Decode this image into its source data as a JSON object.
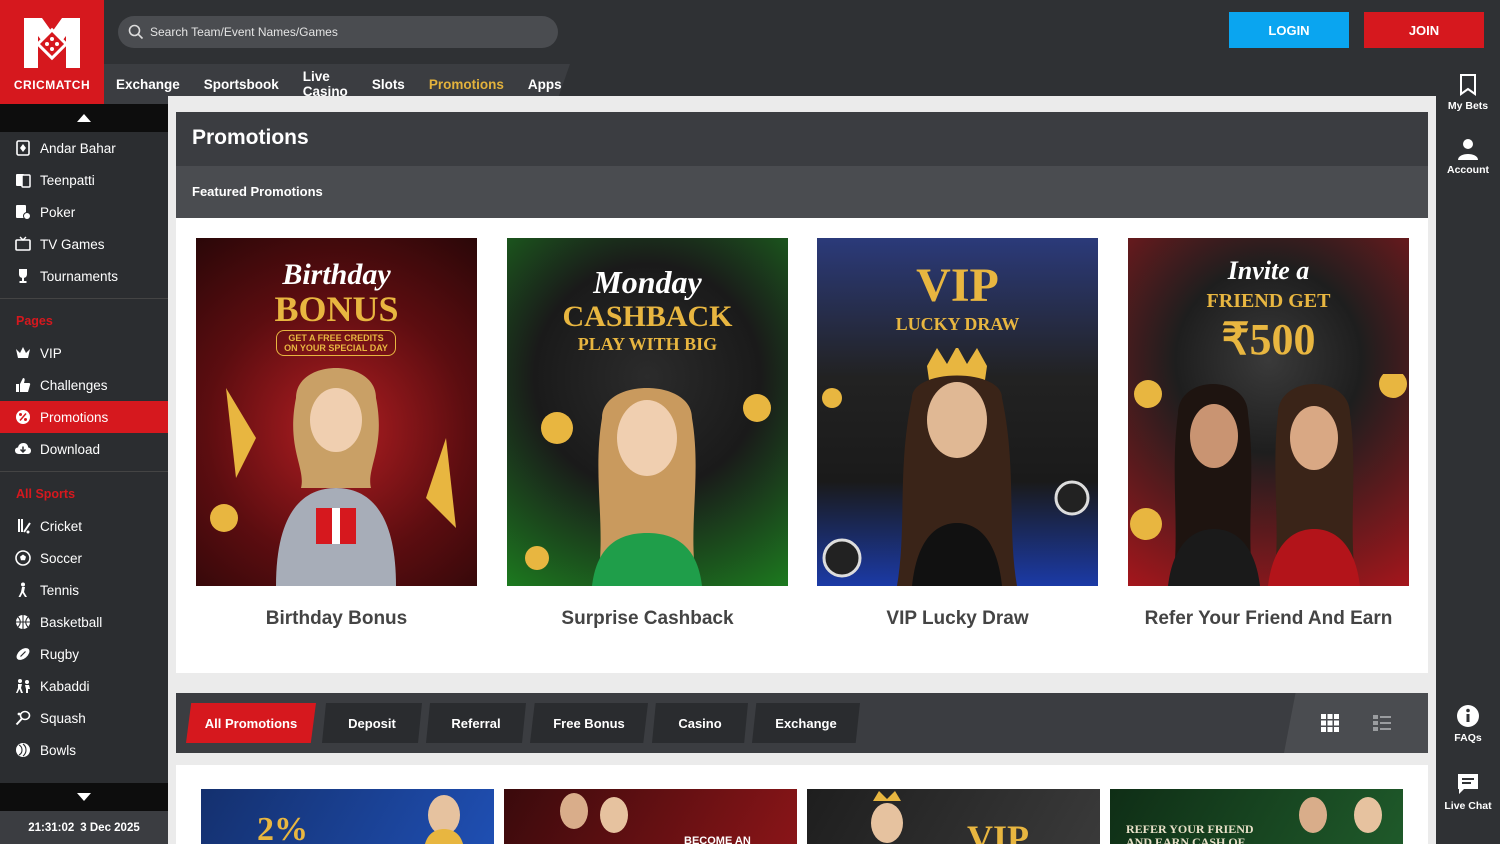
{
  "brand": {
    "name": "CRICMATCH",
    "primary_color": "#d6181e",
    "accent_color": "#0aa5f0",
    "gold_color": "#e3b23c"
  },
  "header": {
    "search_placeholder": "Search Team/Event Names/Games",
    "login_label": "LOGIN",
    "join_label": "JOIN"
  },
  "nav": {
    "items": [
      {
        "label": "Exchange",
        "active": false
      },
      {
        "label": "Sportsbook",
        "active": false
      },
      {
        "label": "Live Casino",
        "active": false
      },
      {
        "label": "Slots",
        "active": false
      },
      {
        "label": "Promotions",
        "active": true
      },
      {
        "label": "Apps",
        "active": false
      }
    ]
  },
  "rightrail": {
    "my_bets": "My Bets",
    "account": "Account",
    "faqs": "FAQs",
    "live_chat": "Live Chat"
  },
  "sidebar": {
    "top_items": [
      {
        "label": "Andar Bahar",
        "icon": "andar-bahar-icon"
      },
      {
        "label": "Teenpatti",
        "icon": "teenpatti-icon"
      },
      {
        "label": "Poker",
        "icon": "poker-icon"
      },
      {
        "label": "TV Games",
        "icon": "tv-icon"
      },
      {
        "label": "Tournaments",
        "icon": "trophy-icon"
      }
    ],
    "pages_heading": "Pages",
    "pages": [
      {
        "label": "VIP",
        "icon": "crown-icon",
        "active": false
      },
      {
        "label": "Challenges",
        "icon": "thumbs-up-icon",
        "active": false
      },
      {
        "label": "Promotions",
        "icon": "promotions-icon",
        "active": true
      },
      {
        "label": "Download",
        "icon": "download-icon",
        "active": false
      }
    ],
    "sports_heading": "All Sports",
    "sports": [
      {
        "label": "Cricket",
        "icon": "cricket-icon"
      },
      {
        "label": "Soccer",
        "icon": "soccer-icon"
      },
      {
        "label": "Tennis",
        "icon": "tennis-icon"
      },
      {
        "label": "Basketball",
        "icon": "basketball-icon"
      },
      {
        "label": "Rugby",
        "icon": "rugby-icon"
      },
      {
        "label": "Kabaddi",
        "icon": "kabaddi-icon"
      },
      {
        "label": "Squash",
        "icon": "squash-icon"
      },
      {
        "label": "Bowls",
        "icon": "bowls-icon"
      }
    ],
    "time": "21:31:02",
    "date": "3 Dec 2025"
  },
  "promotions": {
    "title": "Promotions",
    "featured_heading": "Featured Promotions",
    "featured": [
      {
        "title": "Birthday Bonus",
        "art_line1": "Birthday",
        "art_line2": "BONUS",
        "art_line3": "GET A FREE CREDITS ON YOUR SPECIAL DAY",
        "bg": "#7a1416"
      },
      {
        "title": "Surprise Cashback",
        "art_line1": "Monday",
        "art_line2": "CASHBACK",
        "art_line3": "PLAY WITH BIG",
        "bg": "#1c6b1f"
      },
      {
        "title": "VIP Lucky Draw",
        "art_line1": "",
        "art_line2": "VIP",
        "art_line3": "LUCKY DRAW",
        "bg": "#152a6e"
      },
      {
        "title": "Refer Your Friend And Earn",
        "art_line1": "Invite a",
        "art_line2": "FRIEND GET",
        "art_line3": "₹500",
        "bg": "#8a1518"
      }
    ],
    "filters": [
      {
        "label": "All Promotions",
        "active": true
      },
      {
        "label": "Deposit",
        "active": false
      },
      {
        "label": "Referral",
        "active": false
      },
      {
        "label": "Free Bonus",
        "active": false
      },
      {
        "label": "Casino",
        "active": false
      },
      {
        "label": "Exchange",
        "active": false
      }
    ],
    "thumbs": [
      {
        "text": "2%",
        "bg": "#1a3a8a"
      },
      {
        "text": "BECOME AN",
        "bg": "#6e1216"
      },
      {
        "text": "VIP",
        "bg": "#2a2a2a"
      },
      {
        "text": "REFER YOUR FRIEND AND EARN CASH OF",
        "bg": "#173f1e"
      }
    ]
  }
}
